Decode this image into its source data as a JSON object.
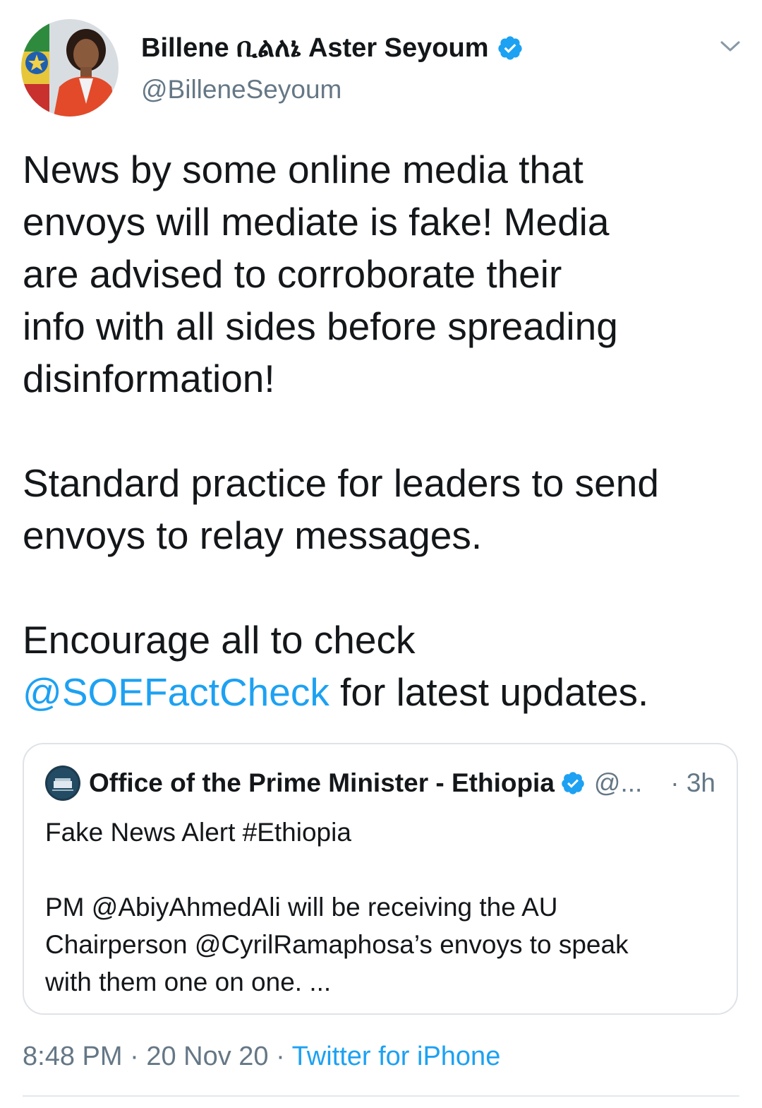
{
  "author": {
    "display_name": "Billene ቢልለኔ Aster Seyoum",
    "handle": "@BilleneSeyoum",
    "verified": true
  },
  "tweet": {
    "paragraphs": [
      {
        "lines": [
          "News by some online media that",
          "envoys will mediate is fake! Media",
          "are advised to corroborate their",
          "info with all sides before spreading",
          "disinformation!"
        ]
      },
      {
        "lines": [
          "Standard practice for leaders to send",
          "envoys to relay messages."
        ]
      },
      {
        "line1": "Encourage all to check",
        "mention": "@SOEFactCheck",
        "after_mention": " for latest updates."
      }
    ]
  },
  "quoted_tweet": {
    "display_name": "Office of the Prime Minister - Ethiopia",
    "handle": "@...",
    "time": "· 3h",
    "verified": true,
    "text_lines": [
      "Fake News Alert #Ethiopia",
      "",
      "PM @AbiyAhmedAli will be receiving the AU",
      "Chairperson @CyrilRamaphosa’s envoys to speak",
      "with them one on one. ..."
    ]
  },
  "meta": {
    "time": "8:48 PM",
    "sep1": " · ",
    "date": "20 Nov 20",
    "sep2": " · ",
    "source": "Twitter for iPhone"
  },
  "icons": {
    "verified_badge": "verified-badge-icon",
    "menu": "chevron-down-icon"
  },
  "colors": {
    "link": "#1da1f2",
    "secondary_text": "#657786",
    "primary_text": "#14171a",
    "border": "#dfe3e8"
  }
}
